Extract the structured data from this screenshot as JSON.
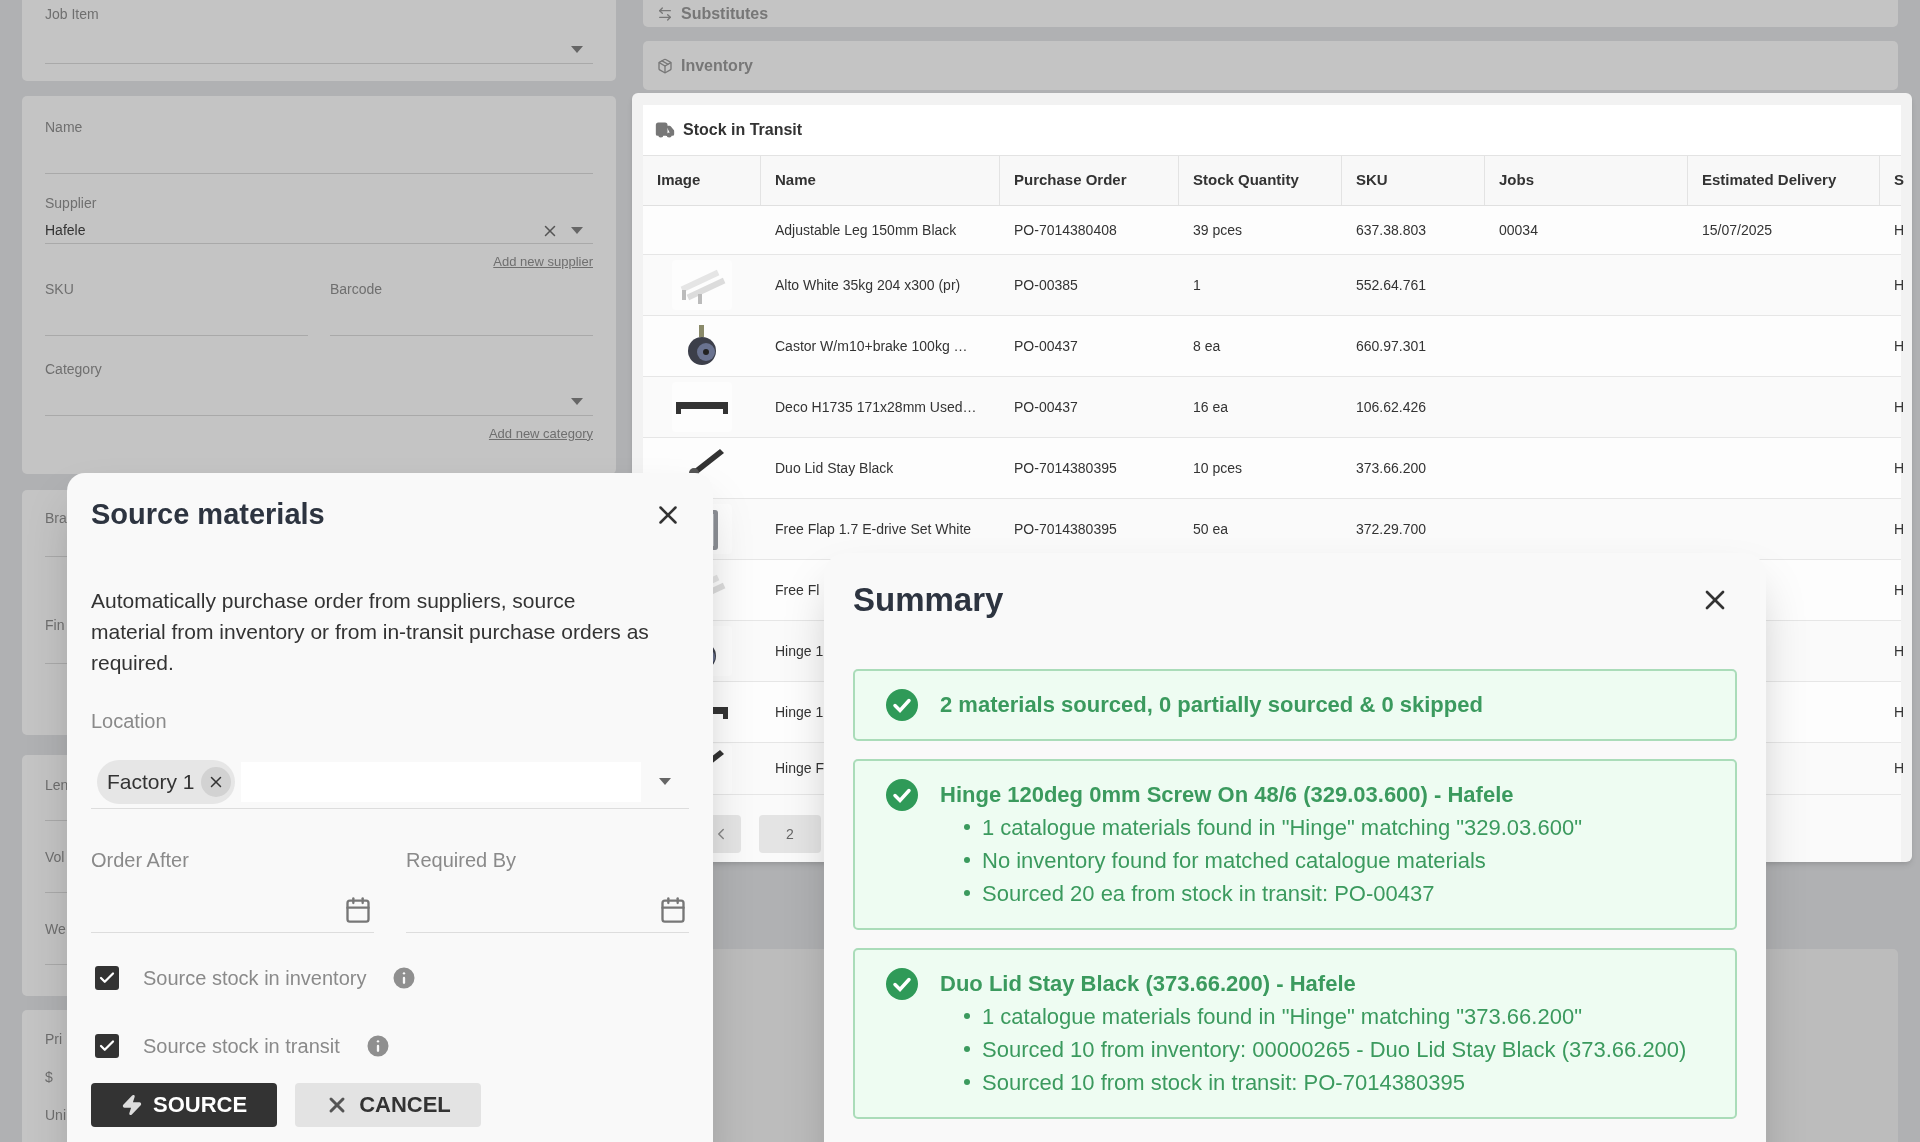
{
  "job_item_card": {
    "label": "Job Item"
  },
  "details_card": {
    "name_label": "Name",
    "supplier_label": "Supplier",
    "supplier_value": "Hafele",
    "add_supplier_link": "Add new supplier",
    "sku_label": "SKU",
    "barcode_label": "Barcode",
    "category_label": "Category",
    "add_category_link": "Add new category"
  },
  "covered_cards": [
    {
      "labels": [
        "Bra",
        "Fin"
      ]
    },
    {
      "labels": [
        "Len",
        "Vol",
        "We"
      ]
    },
    {
      "labels": [
        "Pri",
        "$",
        "Uni"
      ]
    }
  ],
  "sections": [
    {
      "kind": "substitutes",
      "title": "Substitutes"
    },
    {
      "kind": "inventory",
      "title": "Inventory"
    }
  ],
  "stock_in_transit": {
    "title": "Stock in Transit",
    "columns": [
      "Image",
      "Name",
      "Purchase Order",
      "Stock Quantity",
      "SKU",
      "Jobs",
      "Estimated Delivery",
      "S"
    ],
    "rows": [
      {
        "image": false,
        "cells": [
          "",
          "Adjustable Leg 150mm Black",
          "PO-7014380408",
          "39 pces",
          "637.38.803",
          "00034",
          "15/07/2025",
          "H"
        ]
      },
      {
        "image": true,
        "cells": [
          "",
          "Alto White 35kg 204 x300 (pr)",
          "PO-00385",
          "1",
          "552.64.761",
          "",
          "",
          "H"
        ]
      },
      {
        "image": true,
        "cells": [
          "",
          "Castor W/m10+brake 100kg …",
          "PO-00437",
          "8 ea",
          "660.97.301",
          "",
          "",
          "H"
        ]
      },
      {
        "image": true,
        "cells": [
          "",
          "Deco H1735 171x28mm Used…",
          "PO-00437",
          "16 ea",
          "106.62.426",
          "",
          "",
          "H"
        ]
      },
      {
        "image": true,
        "cells": [
          "",
          "Duo Lid Stay Black",
          "PO-7014380395",
          "10 pces",
          "373.66.200",
          "",
          "",
          "H"
        ]
      },
      {
        "image": true,
        "cells": [
          "",
          "Free Flap 1.7 E-drive Set White",
          "PO-7014380395",
          "50 ea",
          "372.29.700",
          "",
          "",
          "H"
        ]
      },
      {
        "image": true,
        "cells": [
          "",
          "Free Fl",
          "",
          "",
          "",
          "",
          "",
          "H"
        ]
      },
      {
        "image": true,
        "cells": [
          "",
          "Hinge 1",
          "",
          "",
          "",
          "",
          "",
          "H"
        ]
      },
      {
        "image": true,
        "cells": [
          "",
          "Hinge 1",
          "",
          "",
          "",
          "",
          "",
          "H"
        ]
      },
      {
        "image": true,
        "cells": [
          "",
          "Hinge F",
          "",
          "",
          "",
          "",
          "",
          "H"
        ]
      }
    ],
    "pages": [
      "2"
    ]
  },
  "source_dialog": {
    "title": "Source materials",
    "description": "Automatically purchase order from suppliers, source material from inventory or from in-transit purchase orders as required.",
    "location": {
      "label": "Location",
      "chips": [
        "Factory 1"
      ]
    },
    "dates": [
      {
        "label": "Order After"
      },
      {
        "label": "Required By"
      }
    ],
    "options": [
      {
        "label": "Source stock in inventory",
        "checked": true
      },
      {
        "label": "Source stock in transit",
        "checked": true
      }
    ],
    "buttons": [
      {
        "kind": "primary",
        "label": "SOURCE"
      },
      {
        "kind": "secondary",
        "label": "CANCEL"
      }
    ]
  },
  "summary_dialog": {
    "title": "Summary",
    "results": [
      {
        "title": "2 materials sourced, 0 partially sourced & 0 skipped"
      },
      {
        "title": "Hinge 120deg 0mm Screw On 48/6 (329.03.600) - Hafele",
        "bullets": [
          "1 catalogue materials found in \"Hinge\" matching \"329.03.600\"",
          "No inventory found for matched catalogue materials",
          "Sourced 20 ea from stock in transit: PO-00437"
        ]
      },
      {
        "title": "Duo Lid Stay Black (373.66.200) - Hafele",
        "bullets": [
          "1 catalogue materials found in \"Hinge\" matching \"373.66.200\"",
          "Sourced 10 from inventory: 00000265 - Duo Lid Stay Black (373.66.200)",
          "Sourced 10 from stock in transit: PO-7014380395"
        ]
      }
    ]
  }
}
